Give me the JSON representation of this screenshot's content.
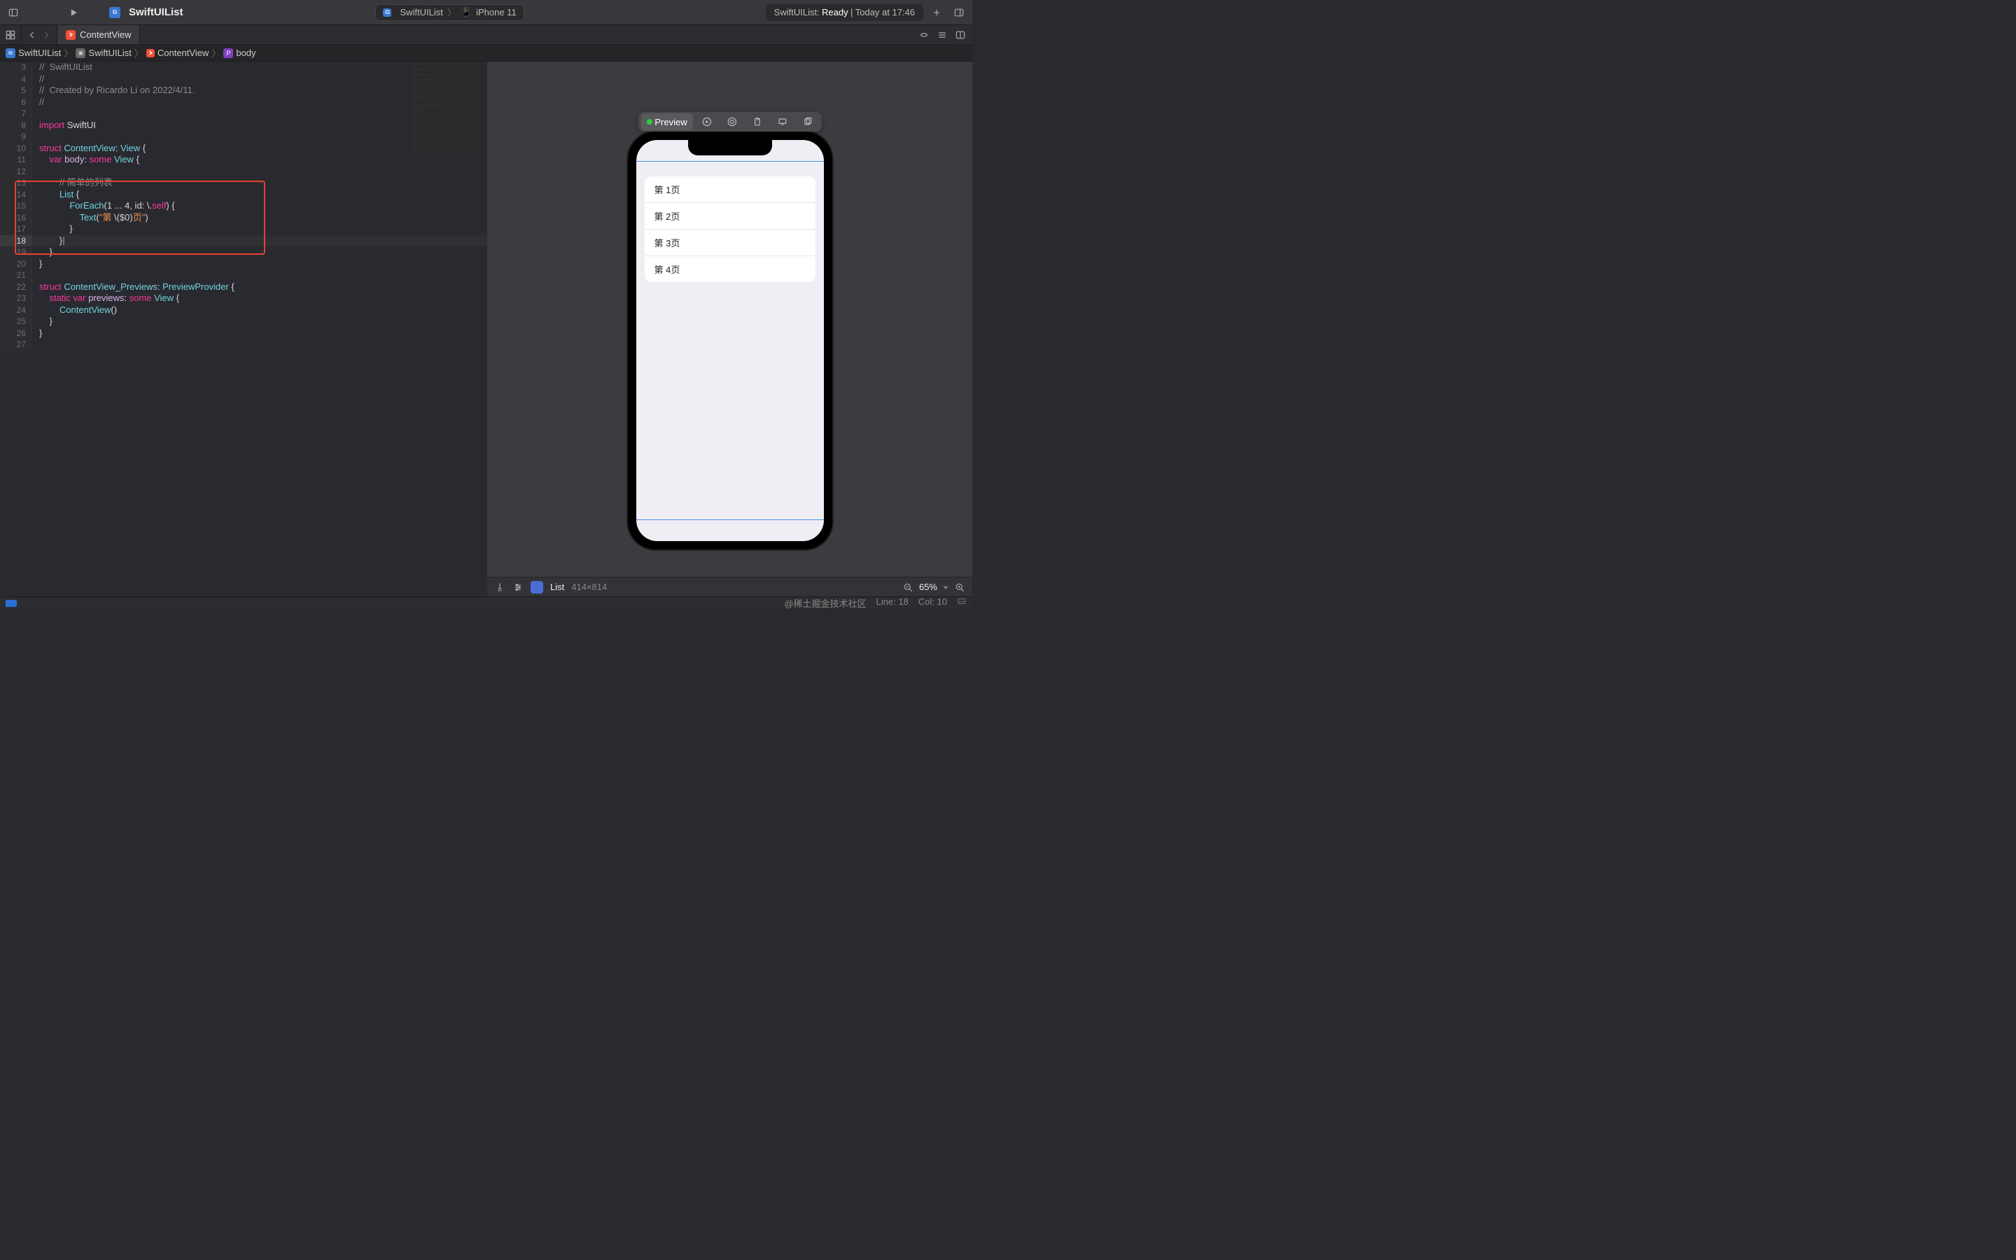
{
  "titlebar": {
    "project": "SwiftUIList",
    "scheme_app": "SwiftUIList",
    "scheme_sep": "〉",
    "scheme_device": "iPhone 11",
    "status": "SwiftUIList: Ready | Today at 17:46",
    "status_app": "SwiftUIList:",
    "status_ready": "Ready",
    "status_rest": "| Today at 17:46"
  },
  "tab": {
    "file": "ContentView"
  },
  "breadcrumb": {
    "items": [
      "SwiftUIList",
      "SwiftUIList",
      "ContentView",
      "body"
    ],
    "p0": "SwiftUIList",
    "p1": "SwiftUIList",
    "p2": "ContentView",
    "p3": "body"
  },
  "code": {
    "lines": [
      {
        "n": 3,
        "html": "<span class='c'>//  SwiftUIList</span>"
      },
      {
        "n": 4,
        "html": "<span class='c'>//</span>"
      },
      {
        "n": 5,
        "html": "<span class='c'>//  Created by Ricardo Li on 2022/4/11.</span>"
      },
      {
        "n": 6,
        "html": "<span class='c'>//</span>"
      },
      {
        "n": 7,
        "html": ""
      },
      {
        "n": 8,
        "html": "<span class='k'>import</span> SwiftUI"
      },
      {
        "n": 9,
        "html": ""
      },
      {
        "n": 10,
        "html": "<span class='k'>struct</span> <span class='t'>ContentView</span>: <span class='t'>View</span> {"
      },
      {
        "n": 11,
        "html": "    <span class='k'>var</span> <span class='p'>body</span>: <span class='k'>some</span> <span class='t'>View</span> {"
      },
      {
        "n": 12,
        "html": "        "
      },
      {
        "n": 13,
        "html": "        <span class='c'>// 简单的列表</span>"
      },
      {
        "n": 14,
        "html": "        <span class='t'>List</span> {"
      },
      {
        "n": 15,
        "html": "            <span class='t'>ForEach</span>(1 ... 4, id: \\.<span class='k'>self</span>) {"
      },
      {
        "n": 16,
        "html": "                <span class='t'>Text</span>(<span class='s'>\"第 </span>\\($0)<span class='s'>页\"</span>)"
      },
      {
        "n": 17,
        "html": "            }"
      },
      {
        "n": 18,
        "html": "        }<span class='n'>|</span>",
        "cur": true
      },
      {
        "n": 19,
        "html": "    }"
      },
      {
        "n": 20,
        "html": "}"
      },
      {
        "n": 21,
        "html": ""
      },
      {
        "n": 22,
        "html": "<span class='k'>struct</span> <span class='t'>ContentView_Previews</span>: <span class='t'>PreviewProvider</span> {"
      },
      {
        "n": 23,
        "html": "    <span class='k'>static</span> <span class='k'>var</span> <span class='p'>previews</span>: <span class='k'>some</span> <span class='t'>View</span> {"
      },
      {
        "n": 24,
        "html": "        <span class='t'>ContentView</span>()"
      },
      {
        "n": 25,
        "html": "    }"
      },
      {
        "n": 26,
        "html": "}"
      },
      {
        "n": 27,
        "html": ""
      }
    ]
  },
  "preview": {
    "toolbar_label": "Preview",
    "list_rows": [
      "第 1页",
      "第 2页",
      "第 3页",
      "第 4页"
    ]
  },
  "preview_bottom": {
    "element": "List",
    "dims": "414×814",
    "zoom": "65%"
  },
  "statusbar": {
    "watermark": "@稀土掘金技术社区",
    "line": "Line: 18",
    "col": "Col: 10"
  }
}
